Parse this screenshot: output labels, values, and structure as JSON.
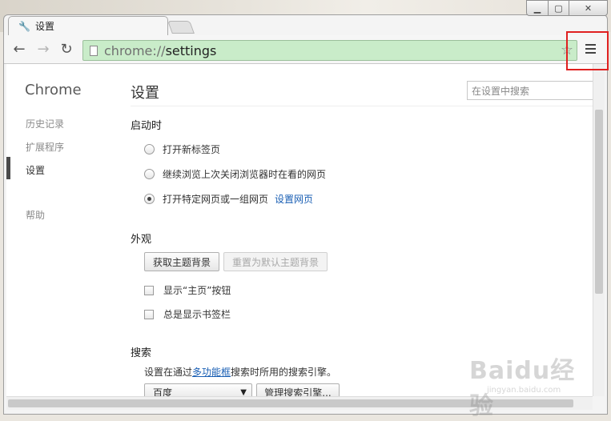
{
  "window": {
    "tab_title": "设置"
  },
  "toolbar": {
    "url_scheme": "chrome://",
    "url_path": "settings"
  },
  "sidebar": {
    "brand": "Chrome",
    "items": [
      {
        "label": "历史记录"
      },
      {
        "label": "扩展程序"
      },
      {
        "label": "设置"
      },
      {
        "label": "帮助"
      }
    ]
  },
  "main": {
    "title": "设置",
    "search_placeholder": "在设置中搜索",
    "startup": {
      "title": "启动时",
      "options": [
        {
          "label": "打开新标签页",
          "selected": false
        },
        {
          "label": "继续浏览上次关闭浏览器时在看的网页",
          "selected": false
        },
        {
          "label": "打开特定网页或一组网页",
          "selected": true
        }
      ],
      "set_pages_link": "设置网页"
    },
    "appearance": {
      "title": "外观",
      "get_themes_button": "获取主题背景",
      "reset_theme_button": "重置为默认主题背景",
      "show_home_button": "显示“主页”按钮",
      "show_bookmarks_bar": "总是显示书签栏"
    },
    "search": {
      "title": "搜索",
      "desc_prefix": "设置在通过",
      "desc_link": "多功能框",
      "desc_suffix": "搜索时所用的搜索引擎。",
      "engine_selected": "百度",
      "manage_button": "管理搜索引擎..."
    }
  },
  "watermark": {
    "main": "Baidu经验",
    "sub": "jingyan.baidu.com"
  }
}
